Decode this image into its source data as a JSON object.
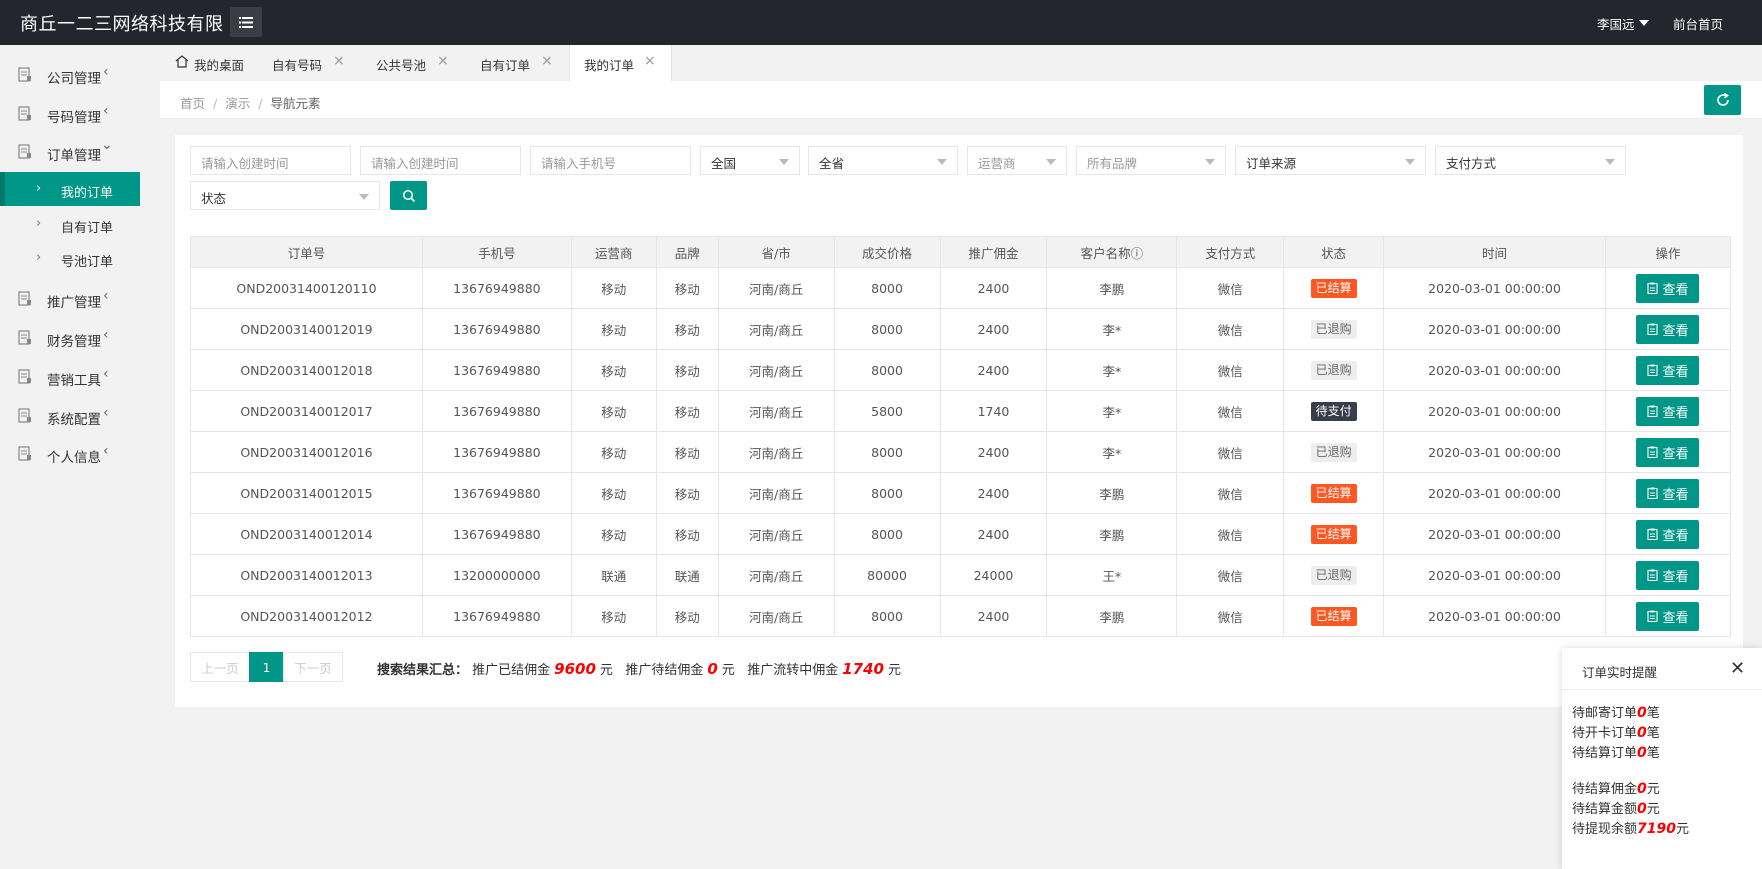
{
  "header": {
    "brand": "商丘一二三网络科技有限",
    "user_name": "李国远",
    "front_link": "前台首页"
  },
  "sidebar": {
    "items": [
      {
        "label": "公司管理",
        "arrow": "‹",
        "icon": "doc-icon"
      },
      {
        "label": "号码管理",
        "arrow": "‹",
        "icon": "doc-icon"
      },
      {
        "label": "订单管理",
        "arrow": "⌄",
        "icon": "doc-icon"
      },
      {
        "label": "推广管理",
        "arrow": "‹",
        "icon": "doc-icon"
      },
      {
        "label": "财务管理",
        "arrow": "‹",
        "icon": "doc-icon"
      },
      {
        "label": "营销工具",
        "arrow": "‹",
        "icon": "doc-icon"
      },
      {
        "label": "系统配置",
        "arrow": "‹",
        "icon": "doc-icon"
      },
      {
        "label": "个人信息",
        "arrow": "‹",
        "icon": "doc-icon"
      }
    ],
    "sub_items": [
      {
        "label": "我的订单",
        "arrow": "›"
      },
      {
        "label": "自有订单",
        "arrow": "›"
      },
      {
        "label": "号池订单",
        "arrow": "›"
      }
    ]
  },
  "tabs": [
    {
      "label": "我的桌面"
    },
    {
      "label": "自有号码"
    },
    {
      "label": "公共号池"
    },
    {
      "label": "自有订单"
    },
    {
      "label": "我的订单"
    }
  ],
  "tab_close": "×",
  "breadcrumb": {
    "home": "首页",
    "demo": "演示",
    "current": "导航元素",
    "sep": "/"
  },
  "filters": {
    "created_start_placeholder": "请输入创建时间",
    "created_end_placeholder": "请输入创建时间",
    "phone_placeholder": "请输入手机号",
    "country": "全国",
    "province": "全省",
    "carrier": "运营商",
    "brand": "所有品牌",
    "source": "订单来源",
    "payment": "支付方式",
    "status": "状态"
  },
  "table": {
    "headers": [
      "订单号",
      "手机号",
      "运营商",
      "品牌",
      "省/市",
      "成交价格",
      "推广佣金",
      "客户名称ⓘ",
      "支付方式",
      "状态",
      "时间",
      "操作"
    ],
    "view_label": "查看",
    "rows": [
      {
        "order": "OND20031400120110",
        "phone": "13676949880",
        "carrier": "移动",
        "brand": "移动",
        "region": "河南/商丘",
        "price": "8000",
        "commission": "2400",
        "customer": "李鹏",
        "pay": "微信",
        "status": "已结算",
        "status_type": "settled",
        "time": "2020-03-01 00:00:00"
      },
      {
        "order": "OND2003140012019",
        "phone": "13676949880",
        "carrier": "移动",
        "brand": "移动",
        "region": "河南/商丘",
        "price": "8000",
        "commission": "2400",
        "customer": "李*",
        "pay": "微信",
        "status": "已退购",
        "status_type": "refunded",
        "time": "2020-03-01 00:00:00"
      },
      {
        "order": "OND2003140012018",
        "phone": "13676949880",
        "carrier": "移动",
        "brand": "移动",
        "region": "河南/商丘",
        "price": "8000",
        "commission": "2400",
        "customer": "李*",
        "pay": "微信",
        "status": "已退购",
        "status_type": "refunded",
        "time": "2020-03-01 00:00:00"
      },
      {
        "order": "OND2003140012017",
        "phone": "13676949880",
        "carrier": "移动",
        "brand": "移动",
        "region": "河南/商丘",
        "price": "5800",
        "commission": "1740",
        "customer": "李*",
        "pay": "微信",
        "status": "待支付",
        "status_type": "pending",
        "time": "2020-03-01 00:00:00"
      },
      {
        "order": "OND2003140012016",
        "phone": "13676949880",
        "carrier": "移动",
        "brand": "移动",
        "region": "河南/商丘",
        "price": "8000",
        "commission": "2400",
        "customer": "李*",
        "pay": "微信",
        "status": "已退购",
        "status_type": "refunded",
        "time": "2020-03-01 00:00:00"
      },
      {
        "order": "OND2003140012015",
        "phone": "13676949880",
        "carrier": "移动",
        "brand": "移动",
        "region": "河南/商丘",
        "price": "8000",
        "commission": "2400",
        "customer": "李鹏",
        "pay": "微信",
        "status": "已结算",
        "status_type": "settled",
        "time": "2020-03-01 00:00:00"
      },
      {
        "order": "OND2003140012014",
        "phone": "13676949880",
        "carrier": "移动",
        "brand": "移动",
        "region": "河南/商丘",
        "price": "8000",
        "commission": "2400",
        "customer": "李鹏",
        "pay": "微信",
        "status": "已结算",
        "status_type": "settled",
        "time": "2020-03-01 00:00:00"
      },
      {
        "order": "OND2003140012013",
        "phone": "13200000000",
        "carrier": "联通",
        "brand": "联通",
        "region": "河南/商丘",
        "price": "80000",
        "commission": "24000",
        "customer": "王*",
        "pay": "微信",
        "status": "已退购",
        "status_type": "refunded",
        "time": "2020-03-01 00:00:00"
      },
      {
        "order": "OND2003140012012",
        "phone": "13676949880",
        "carrier": "移动",
        "brand": "移动",
        "region": "河南/商丘",
        "price": "8000",
        "commission": "2400",
        "customer": "李鹏",
        "pay": "微信",
        "status": "已结算",
        "status_type": "settled",
        "time": "2020-03-01 00:00:00"
      }
    ]
  },
  "pagination": {
    "prev": "上一页",
    "current": "1",
    "next": "下一页"
  },
  "summary": {
    "title": "搜索结果汇总：",
    "settled_label": "推广已结佣金",
    "settled_value": "9600",
    "pending_label": "推广待结佣金",
    "pending_value": "0",
    "flowing_label": "推广流转中佣金",
    "flowing_value": "1740",
    "unit": "元"
  },
  "notification": {
    "title": "订单实时提醒",
    "close": "✕",
    "lines": [
      {
        "prefix": "待邮寄订单",
        "value": "0",
        "suffix": "笔"
      },
      {
        "prefix": "待开卡订单",
        "value": "0",
        "suffix": "笔"
      },
      {
        "prefix": "待结算订单",
        "value": "0",
        "suffix": "笔"
      },
      {
        "prefix": "待结算佣金",
        "value": "0",
        "suffix": "元"
      },
      {
        "prefix": "待结算金额",
        "value": "0",
        "suffix": "元"
      },
      {
        "prefix": "待提现余额",
        "value": "7190",
        "suffix": "元"
      }
    ]
  },
  "colors": {
    "primary": "#009688",
    "header_bg": "#23262e",
    "settled": "#ff5722",
    "pending": "#393d49",
    "highlight": "#ff0000"
  }
}
